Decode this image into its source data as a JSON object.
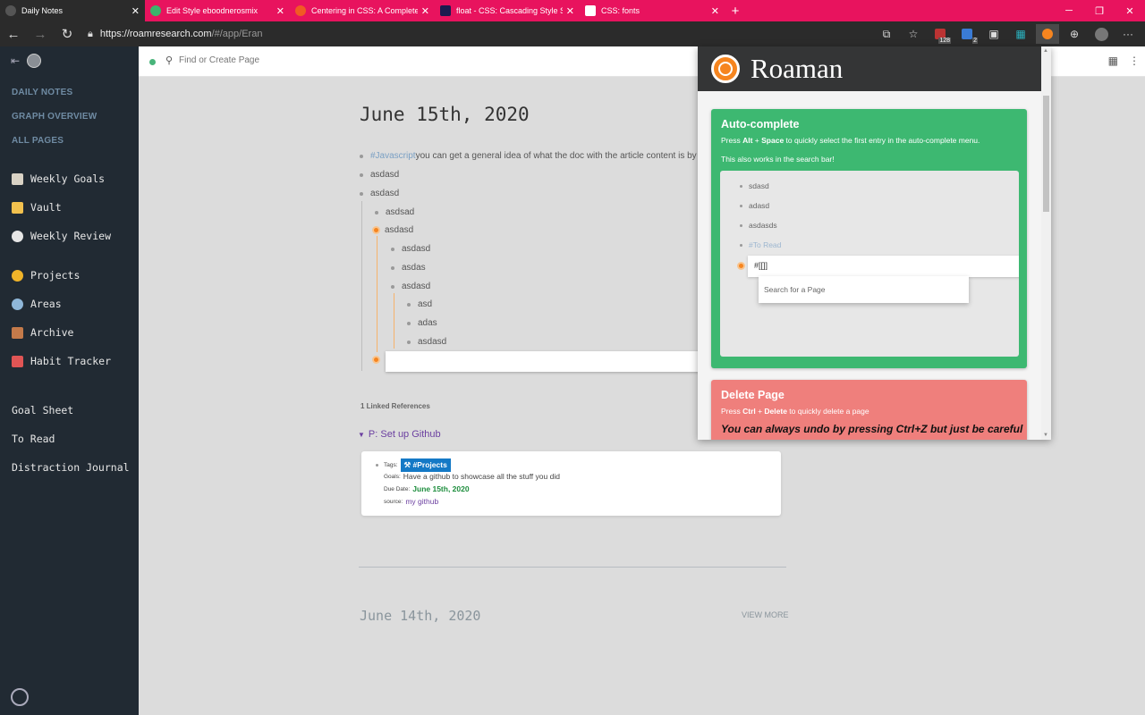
{
  "browser": {
    "tabs": [
      {
        "label": "Daily Notes",
        "active": true,
        "favicon_color": "#555555"
      },
      {
        "label": "Edit Style eboodnerosmix",
        "active": false,
        "favicon_color": "#3bb36b"
      },
      {
        "label": "Centering in CSS: A Complete G",
        "active": false,
        "favicon_color": "#f15a24"
      },
      {
        "label": "float - CSS: Cascading Style Shee",
        "active": false,
        "favicon_color": "#1b1b4f"
      },
      {
        "label": "CSS: fonts",
        "active": false,
        "favicon_color": "#ffffff"
      }
    ],
    "url_host": "https://roamresearch.com",
    "url_path": "/#/app/Eran",
    "extensions": [
      "open-external-icon",
      "star-icon",
      "calendar-ext-icon",
      "sync-ext-icon",
      "reader-ext-icon",
      "grid-ext-icon",
      "roaman-ext-icon",
      "collections-icon",
      "profile-avatar",
      "more-icon"
    ],
    "ext_badges": {
      "calendar": "128",
      "sync": "2"
    },
    "accent": "#e8135e"
  },
  "sidebar": {
    "nav": [
      "DAILY NOTES",
      "GRAPH OVERVIEW",
      "ALL PAGES"
    ],
    "shortcuts": [
      {
        "label": "Weekly Goals",
        "icon": "clipboard-icon",
        "color": "#d9d2c5"
      },
      {
        "label": "Vault",
        "icon": "folder-icon",
        "color": "#f2c14e"
      },
      {
        "label": "Weekly Review",
        "icon": "eye-icon",
        "color": "#e6e6e6"
      },
      {
        "label": "Projects",
        "icon": "palette-icon",
        "color": "#f0b429"
      },
      {
        "label": "Areas",
        "icon": "magnifier-icon",
        "color": "#8fb7d9"
      },
      {
        "label": "Archive",
        "icon": "books-icon",
        "color": "#c47a4a"
      },
      {
        "label": "Habit Tracker",
        "icon": "calendar-icon",
        "color": "#e05555"
      }
    ],
    "pages": [
      "Goal Sheet",
      "To Read",
      "Distraction Journal"
    ]
  },
  "appbar": {
    "search_placeholder": "Find or Create Page"
  },
  "page": {
    "title": "June 15th, 2020",
    "blocks": [
      {
        "tag": "#Javascript",
        "text": " you can get a general idea of what the doc with the article content is by gett"
      },
      {
        "text": "asdasd"
      },
      {
        "text": "asdasd"
      },
      {
        "text": "asdsad"
      },
      {
        "text": "asdasd"
      },
      {
        "text": "asdasd"
      },
      {
        "text": "asdas"
      },
      {
        "text": "asdasd"
      },
      {
        "text": "asd"
      },
      {
        "text": "adas"
      },
      {
        "text": "asdasd"
      }
    ],
    "linked_refs_label": "1 Linked References",
    "ref_page": "P: Set up Github",
    "ref": {
      "tags_key": "Tags:",
      "tag": "#Projects",
      "goals_key": "Goals:",
      "goals": "Have a github to showcase all the stuff you did",
      "due_key": "Due Date:",
      "due": "June 15th, 2020",
      "source_key": "source:",
      "source": "my github"
    },
    "next_day_title": "June 14th, 2020",
    "view_more": "VIEW MORE"
  },
  "popup": {
    "title": "Roaman",
    "autocomplete": {
      "heading": "Auto-complete",
      "desc_pre": "Press ",
      "key1": "Alt",
      "plus": " + ",
      "key2": "Space",
      "desc_post": " to quickly select the first entry in the auto-complete menu.",
      "desc2": "This also works in the search bar!",
      "demo_items": [
        "sdasd",
        "adasd",
        "asdasds"
      ],
      "demo_tag": "#To Read",
      "demo_input": "#[[]]",
      "demo_dropdown": "Search for a Page",
      "color": "#3db871"
    },
    "delete": {
      "heading": "Delete Page",
      "desc_pre": "Press ",
      "key1": "Ctrl",
      "plus": " + ",
      "key2": "Delete",
      "desc_post": " to quickly delete a page",
      "note": "You can always undo by pressing Ctrl+Z but just be careful",
      "color": "#ef7f7c"
    }
  }
}
